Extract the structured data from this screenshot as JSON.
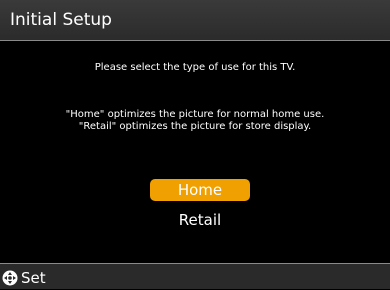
{
  "header": {
    "title": "Initial Setup"
  },
  "main": {
    "prompt": "Please select the type of use for this TV.",
    "description": [
      "\"Home\" optimizes the picture for normal home use.",
      "\"Retail\" optimizes the picture for store display."
    ],
    "options": [
      {
        "label": "Home",
        "selected": true
      },
      {
        "label": "Retail",
        "selected": false
      }
    ]
  },
  "footer": {
    "icon": "dpad-icon",
    "label": "Set"
  },
  "colors": {
    "highlight": "#f0a000",
    "background": "#000000",
    "bar": "#2b2b2b"
  }
}
